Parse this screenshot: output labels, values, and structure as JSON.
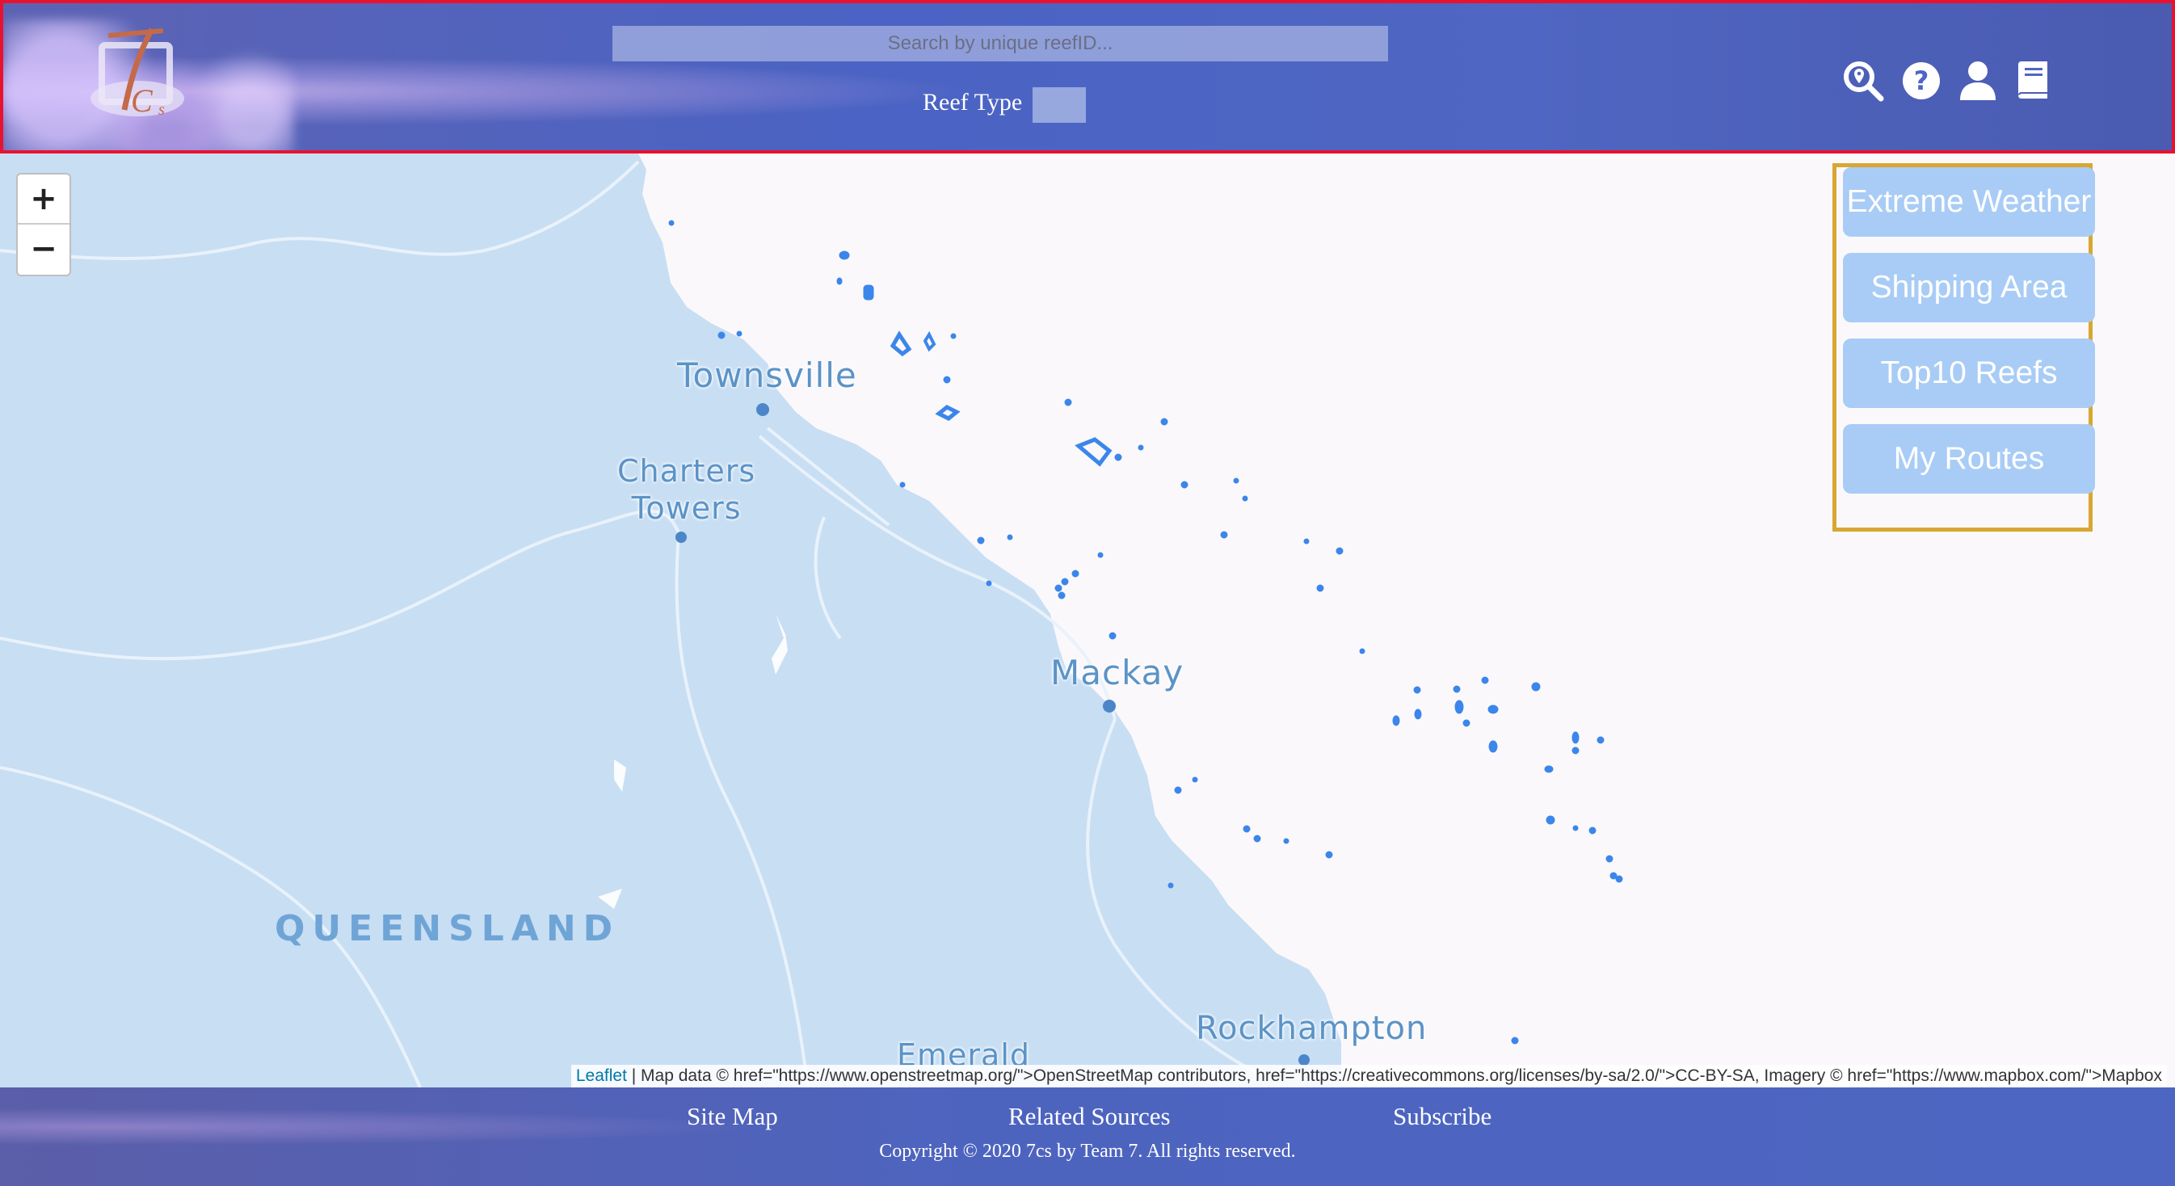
{
  "header": {
    "logo_icon": "7cs-ship-logo",
    "search_placeholder": "Search by unique reefID...",
    "reef_type_label": "Reef Type",
    "icons": [
      "search-location-icon",
      "help-icon",
      "user-icon",
      "book-icon"
    ]
  },
  "map": {
    "cities": [
      {
        "name": "Townsville"
      },
      {
        "name": "Charters\nTowers"
      },
      {
        "name": "Mackay"
      },
      {
        "name": "Rockhampton"
      },
      {
        "name": "Emerald"
      }
    ],
    "region_label": "QUEENSLAND",
    "zoom_in": "+",
    "zoom_out": "−",
    "attribution_link": "Leaflet",
    "attribution_text": " | Map data © href=\"https://www.openstreetmap.org/\">OpenStreetMap contributors, href=\"https://creativecommons.org/licenses/by-sa/2.0/\">CC-BY-SA, Imagery © href=\"https://www.mapbox.com/\">Mapbox",
    "colors": {
      "land": "#c8def3",
      "sea": "#fbf8fb",
      "reef": "#3b86ea",
      "panel_border": "#d8a733",
      "header_border": "#e8122f"
    }
  },
  "panel": {
    "buttons": [
      "Extreme Weather",
      "Shipping Area",
      "Top10 Reefs",
      "My Routes"
    ]
  },
  "footer": {
    "links": [
      "Site Map",
      "Related Sources",
      "Subscribe"
    ],
    "copyright": "Copyright © 2020 7cs by Team 7. All rights reserved."
  }
}
